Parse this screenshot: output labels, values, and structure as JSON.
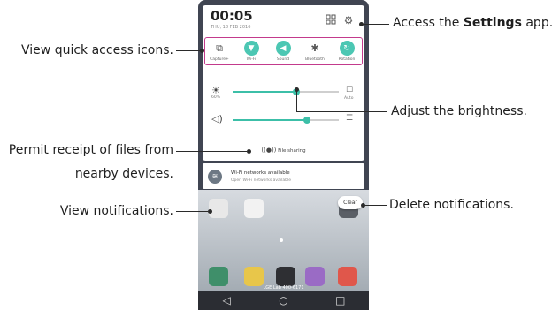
{
  "callouts": {
    "settings_prefix": "Access the ",
    "settings_bold": "Settings",
    "settings_suffix": " app.",
    "quick_access": "View quick access icons.",
    "brightness": "Adjust the brightness.",
    "files_line1": "Permit receipt of files from",
    "files_line2": "nearby devices.",
    "notifications": "View notifications.",
    "delete": "Delete notifications."
  },
  "phone": {
    "time": "00:05",
    "date": "THU, 18 FEB 2016",
    "top_icons": [
      "apps-grid-icon",
      "settings-gear-icon"
    ],
    "quick_access": [
      {
        "label": "Capture+",
        "icon": "capture-icon",
        "active": false
      },
      {
        "label": "Wi-Fi",
        "icon": "wifi-icon",
        "active": true
      },
      {
        "label": "Sound",
        "icon": "sound-icon",
        "active": true
      },
      {
        "label": "Bluetooth",
        "icon": "bluetooth-icon",
        "active": false
      },
      {
        "label": "Rotation",
        "icon": "rotation-icon",
        "active": true
      }
    ],
    "brightness_label": "60%",
    "brightness_level": 0.6,
    "auto_label": "Auto",
    "volume_level": 0.7,
    "file_sharing": "File sharing",
    "notification": {
      "title": "Wi-Fi networks available",
      "subtitle": "Open Wi-Fi networks available"
    },
    "clear_label": "Clear",
    "carrier": "LGE Lab 400-6171",
    "nav": [
      "◁",
      "○",
      "□"
    ]
  },
  "colors": {
    "accent": "#3cbfa8",
    "highlight": "#c33a8c"
  }
}
